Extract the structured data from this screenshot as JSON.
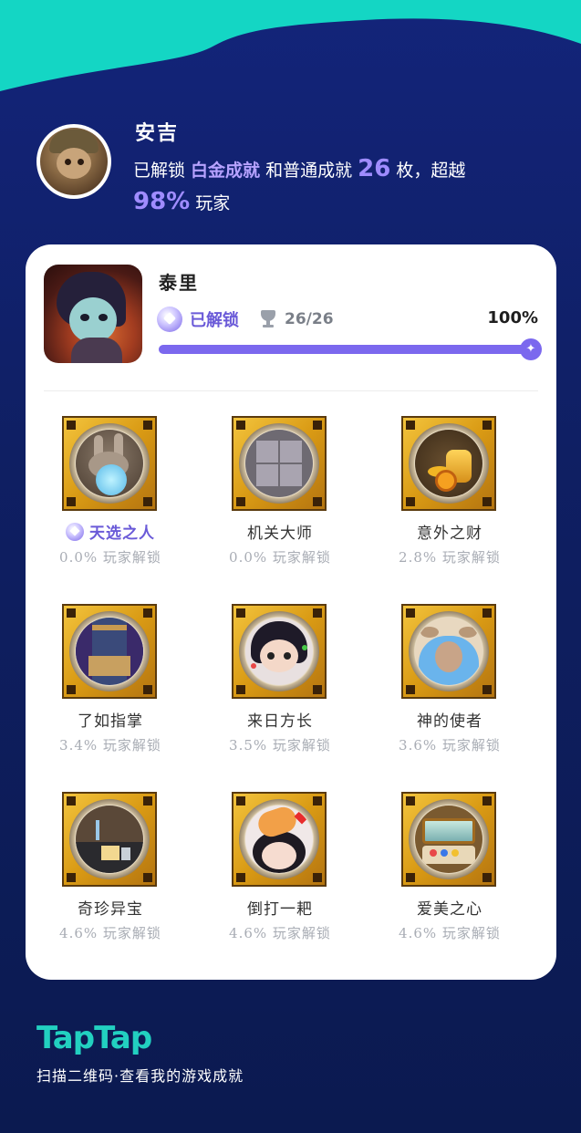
{
  "header": {
    "username": "安吉",
    "summary_prefix": "已解锁 ",
    "platinum": "白金成就",
    "summary_middle": " 和普通成就 ",
    "count": "26",
    "summary_suffix": " 枚，超越",
    "beat_percent": "98%",
    "beat_suffix": " 玩家"
  },
  "game": {
    "title": "泰里",
    "status": "已解锁",
    "trophy_count": "26/26",
    "percent": "100%",
    "progress": 1.0
  },
  "achievements": [
    {
      "name": "天选之人",
      "rate": "0.0% 玩家解锁",
      "unlocked_badge": true,
      "art": "rabbit-bubble"
    },
    {
      "name": "机关大师",
      "rate": "0.0% 玩家解锁",
      "unlocked_badge": false,
      "art": "stone-tiles"
    },
    {
      "name": "意外之财",
      "rate": "2.8% 玩家解锁",
      "unlocked_badge": false,
      "art": "gold-coins"
    },
    {
      "name": "了如指掌",
      "rate": "3.4% 玩家解锁",
      "unlocked_badge": false,
      "art": "curtain-table"
    },
    {
      "name": "来日方长",
      "rate": "3.5% 玩家解锁",
      "unlocked_badge": false,
      "art": "dark-hair-girl"
    },
    {
      "name": "神的使者",
      "rate": "3.6% 玩家解锁",
      "unlocked_badge": false,
      "art": "blue-hair-rabbit"
    },
    {
      "name": "奇珍异宝",
      "rate": "4.6% 玩家解锁",
      "unlocked_badge": false,
      "art": "treasure-items"
    },
    {
      "name": "倒打一耙",
      "rate": "4.6% 玩家解锁",
      "unlocked_badge": false,
      "art": "slapped-face"
    },
    {
      "name": "爱美之心",
      "rate": "4.6% 玩家解锁",
      "unlocked_badge": false,
      "art": "makeup-box"
    }
  ],
  "footer": {
    "brand": "TapTap",
    "text": "扫描二维码·查看我的游戏成就"
  },
  "colors": {
    "background": "#0f1f63",
    "wave": "#14d6c4",
    "accent": "#7b68ee",
    "brand": "#22d0c0"
  }
}
